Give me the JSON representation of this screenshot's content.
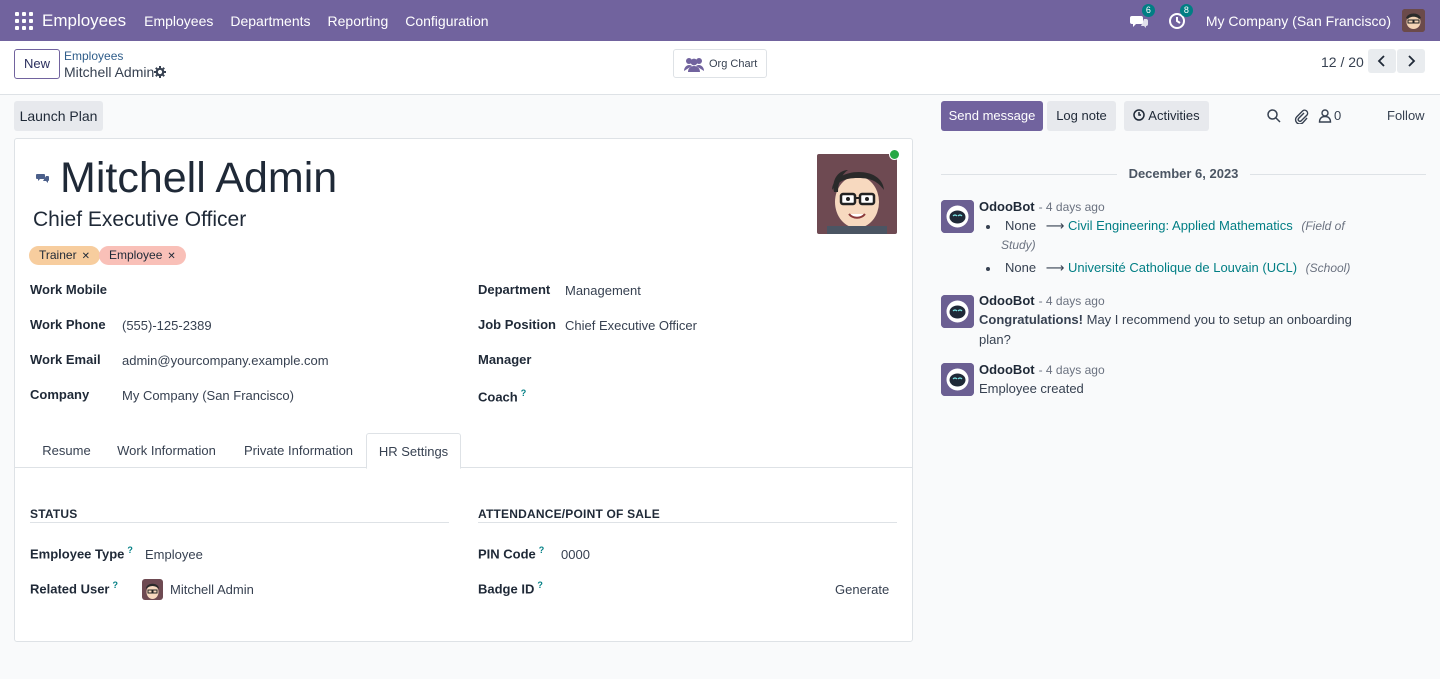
{
  "navbar": {
    "app_name": "Employees",
    "menu": [
      "Employees",
      "Departments",
      "Reporting",
      "Configuration"
    ],
    "messages_badge": "6",
    "activities_badge": "8",
    "company": "My Company (San Francisco)"
  },
  "control": {
    "new_label": "New",
    "breadcrumb_parent": "Employees",
    "breadcrumb_current": "Mitchell Admin",
    "org_chart_label": "Org Chart",
    "pager": "12 / 20"
  },
  "form": {
    "launch_plan_label": "Launch Plan",
    "name": "Mitchell Admin",
    "job_title": "Chief Executive Officer",
    "tags": [
      "Trainer",
      "Employee"
    ],
    "left_fields": [
      {
        "label": "Work Mobile",
        "value": ""
      },
      {
        "label": "Work Phone",
        "value": "(555)-125-2389"
      },
      {
        "label": "Work Email",
        "value": "admin@yourcompany.example.com"
      },
      {
        "label": "Company",
        "value": "My Company (San Francisco)"
      }
    ],
    "right_fields": [
      {
        "label": "Department",
        "value": "Management"
      },
      {
        "label": "Job Position",
        "value": "Chief Executive Officer"
      },
      {
        "label": "Manager",
        "value": ""
      },
      {
        "label": "Coach",
        "value": ""
      }
    ],
    "tabs": [
      "Resume",
      "Work Information",
      "Private Information",
      "HR Settings"
    ],
    "active_tab": "HR Settings",
    "hr": {
      "status_title": "STATUS",
      "attendance_title": "ATTENDANCE/POINT OF SALE",
      "employee_type_label": "Employee Type",
      "employee_type_value": "Employee",
      "related_user_label": "Related User",
      "related_user_value": "Mitchell Admin",
      "pin_label": "PIN Code",
      "pin_value": "0000",
      "badge_label": "Badge ID",
      "generate_label": "Generate"
    }
  },
  "chatter": {
    "send_message": "Send message",
    "log_note": "Log note",
    "activities": "Activities",
    "followers_count": "0",
    "follow": "Follow",
    "date": "December 6, 2023",
    "messages": [
      {
        "author": "OdooBot",
        "time": "- 4 days ago",
        "changes": [
          {
            "old": "None",
            "arrow": "⟶",
            "new": "Civil Engineering: Applied Mathematics",
            "field_a": "(Field of",
            "field_b": "Study)"
          },
          {
            "old": "None",
            "arrow": "⟶",
            "new": "Université Catholique de Louvain (UCL)",
            "field": "(School)"
          }
        ]
      },
      {
        "author": "OdooBot",
        "time": "- 4 days ago",
        "bold": "Congratulations!",
        "text_a": " May I recommend you to setup an onboarding",
        "text_b": "plan?"
      },
      {
        "author": "OdooBot",
        "time": "- 4 days ago",
        "text": "Employee created"
      }
    ]
  }
}
